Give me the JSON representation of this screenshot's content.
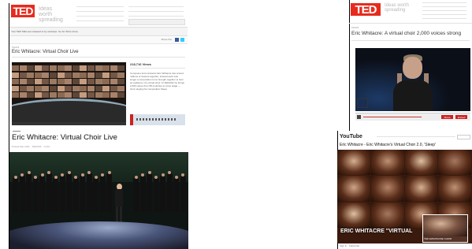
{
  "top_left": {
    "brand": "TED",
    "tagline": "Ideas worth spreading",
    "notice": "Your TED Talks are released to by volunteer. Go for Tell to know",
    "section": "TALKS",
    "title": "Eric Whitacre: Virtual Choir Live",
    "meta": "Posted April 2011 • TED2011 · 14:39",
    "stats": "218,716 Views",
    "share_label": "Share this",
    "description": "Composer and conductor Eric Whitacre has scored millions of viewers together; instead each solo singer a composition to be brought together to form an audience of a virtual choir. At TED2011 he brings 2,000 voices from 58 countries to a live stage — choir singing his composition Sleep."
  },
  "bottom_left": {
    "title": "Eric Whitacre: Virtual Choir Live",
    "meta": "Posted Mar 2011 · TED2011 · 14:39"
  },
  "top_right": {
    "brand": "TED",
    "tagline": "Ideas worth spreading",
    "section": "TALKS",
    "title": "Eric Whitacre: A virtual choir 2,000 voices strong",
    "buttons": [
      "Share",
      "Embed"
    ]
  },
  "bottom_right": {
    "brand": "YouTube",
    "title": "Eric Whitacre - Eric Whitacre's Virtual Choir 2.0, 'Sleep'",
    "overlay_text": "ERIC WHITACRE \"VIRTUAL",
    "small_overlay": "TED EWHITACRE CHOIR",
    "footer": "Sign in · Subscribe"
  },
  "colors": {
    "ted_red": "#e62b1e",
    "youtube_red": "#cc181e"
  }
}
